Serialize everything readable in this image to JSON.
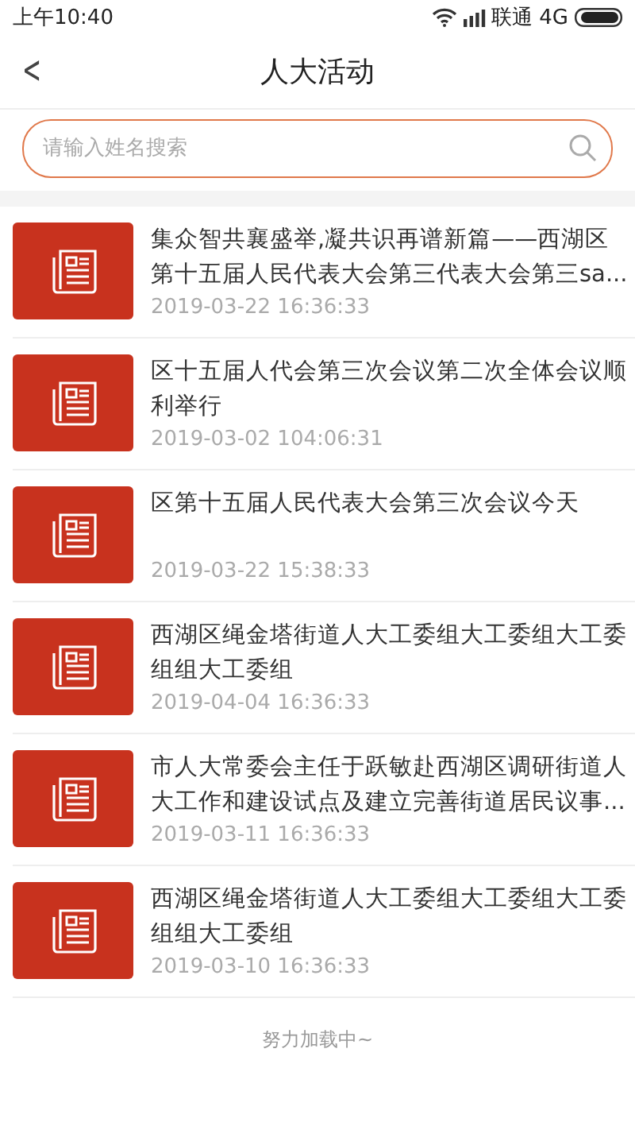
{
  "status_bar": {
    "time": "上午10:40",
    "carrier": "联通 4G"
  },
  "header": {
    "back": "<",
    "title": "人大活动"
  },
  "search": {
    "placeholder": "请输入姓名搜索"
  },
  "articles": [
    {
      "title": "集众智共襄盛举,凝共识再谱新篇——西湖区第十五届人民代表大会第三代表大会第三sa...",
      "date": "2019-03-22 16:36:33"
    },
    {
      "title": "区十五届人代会第三次会议第二次全体会议顺利举行",
      "date": "2019-03-02 104:06:31"
    },
    {
      "title": "区第十五届人民代表大会第三次会议今天",
      "date": "2019-03-22 15:38:33"
    },
    {
      "title": "西湖区绳金塔街道人大工委组大工委组大工委组组大工委组",
      "date": "2019-04-04 16:36:33"
    },
    {
      "title": "市人大常委会主任于跃敏赴西湖区调研街道人大工作和建设试点及建立完善街道居民议事...",
      "date": "2019-03-11 16:36:33"
    },
    {
      "title": "西湖区绳金塔街道人大工委组大工委组大工委组组大工委组",
      "date": "2019-03-10 16:36:33"
    }
  ],
  "loading": "努力加载中~"
}
